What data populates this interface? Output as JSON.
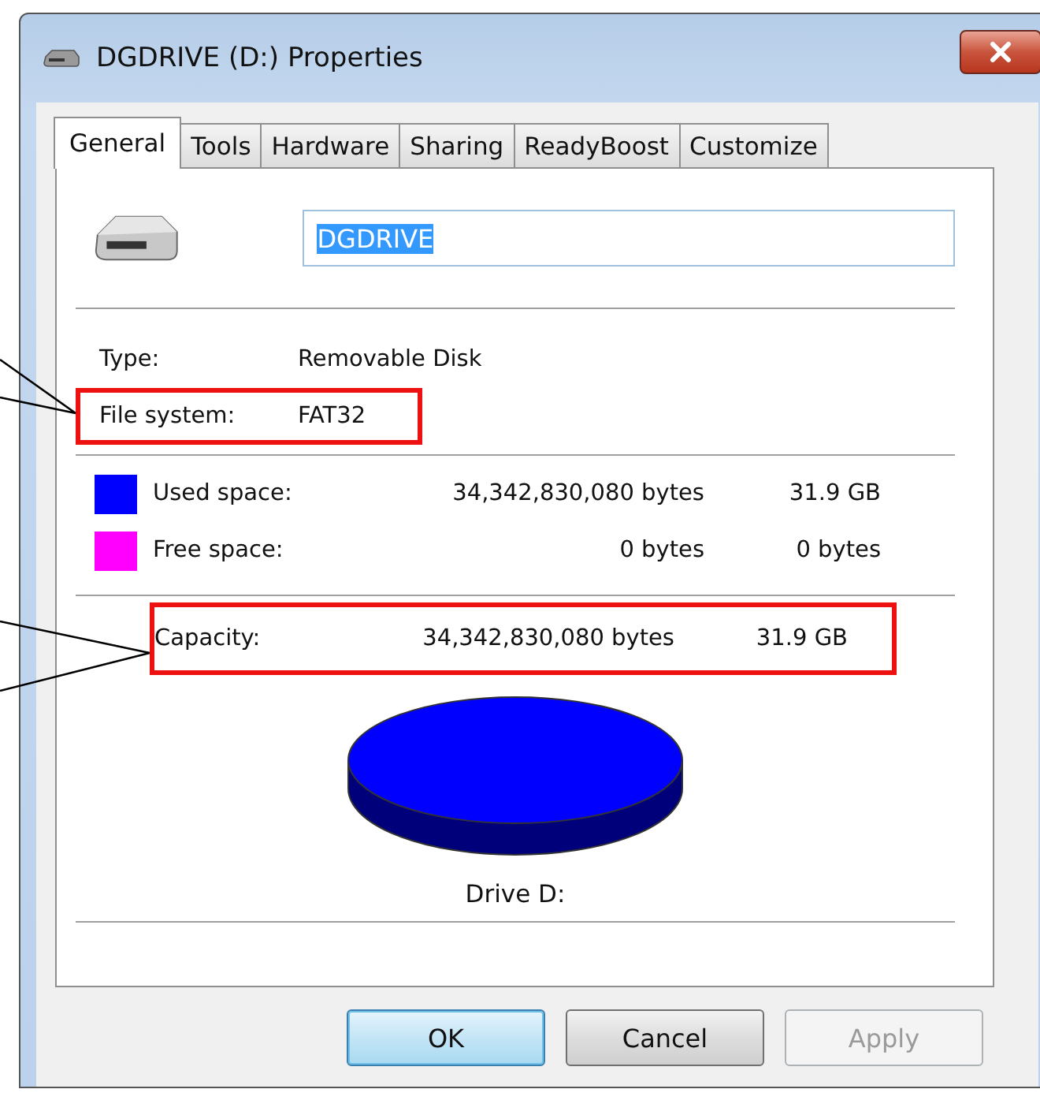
{
  "window": {
    "title": "DGDRIVE (D:) Properties"
  },
  "tabs": [
    {
      "label": "General",
      "selected": true
    },
    {
      "label": "Tools",
      "selected": false
    },
    {
      "label": "Hardware",
      "selected": false
    },
    {
      "label": "Sharing",
      "selected": false
    },
    {
      "label": "ReadyBoost",
      "selected": false
    },
    {
      "label": "Customize",
      "selected": false
    }
  ],
  "name_field": {
    "value": "DGDRIVE",
    "text_selected": true
  },
  "info": [
    {
      "label": "Type:",
      "value": "Removable Disk",
      "highlighted": false
    },
    {
      "label": "File system:",
      "value": "FAT32",
      "highlighted": true
    }
  ],
  "space": [
    {
      "label": "Used space:",
      "bytes": "34,342,830,080 bytes",
      "size": "31.9 GB",
      "color": "#0000ff"
    },
    {
      "label": "Free space:",
      "bytes": "0 bytes",
      "size": "0 bytes",
      "color": "#ff00ff"
    }
  ],
  "capacity": {
    "label": "Capacity:",
    "bytes": "34,342,830,080 bytes",
    "size": "31.9 GB",
    "highlighted": true
  },
  "drive_label": "Drive D:",
  "buttons": [
    {
      "label": "OK",
      "default": true,
      "disabled": false
    },
    {
      "label": "Cancel",
      "default": false,
      "disabled": false
    },
    {
      "label": "Apply",
      "default": false,
      "disabled": true
    }
  ]
}
